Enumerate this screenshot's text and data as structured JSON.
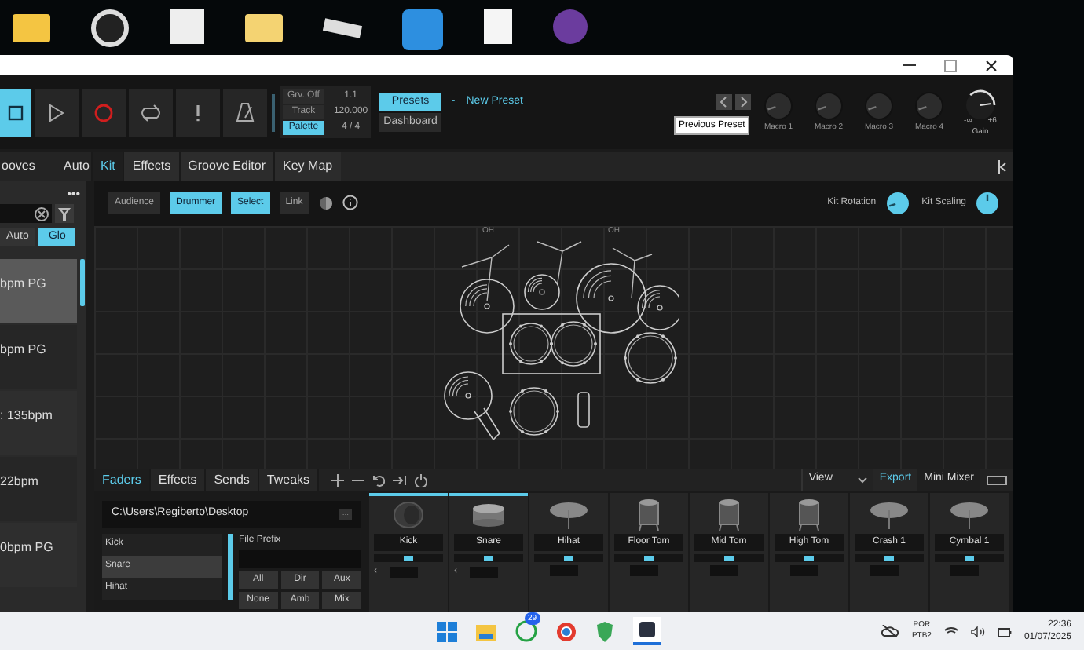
{
  "toolbar": {
    "transport": [
      {
        "kind": "stop",
        "selected": true
      },
      {
        "kind": "play",
        "selected": false
      },
      {
        "kind": "record",
        "selected": false
      },
      {
        "kind": "loop",
        "selected": false
      },
      {
        "kind": "alert",
        "selected": false
      },
      {
        "kind": "metronome",
        "selected": false
      }
    ],
    "info": [
      {
        "label": "Grv. Off",
        "value": "1.1",
        "selected": false
      },
      {
        "label": "Track",
        "value": "120.000",
        "selected": false
      },
      {
        "label": "Palette",
        "value": "4 / 4",
        "selected": true
      }
    ],
    "views": [
      {
        "label": "Presets",
        "selected": true
      },
      {
        "label": "Dashboard",
        "selected": false
      }
    ],
    "preset": {
      "separator": "-",
      "name": "New Preset"
    },
    "tooltip": "Previous Preset",
    "macros": [
      {
        "label": "Macro 1"
      },
      {
        "label": "Macro 2"
      },
      {
        "label": "Macro 3"
      },
      {
        "label": "Macro 4"
      }
    ],
    "gain": {
      "label": "Gain",
      "min": "-∞",
      "max": "+6"
    }
  },
  "left_tabs": [
    {
      "label": "ooves",
      "selected": false
    },
    {
      "label": "Auto",
      "selected": false
    }
  ],
  "tabs": [
    {
      "label": "Kit",
      "selected": true
    },
    {
      "label": "Effects",
      "selected": false
    },
    {
      "label": "Groove Editor",
      "selected": false
    },
    {
      "label": "Key Map",
      "selected": false
    }
  ],
  "browser": {
    "menu": "•••",
    "filters": [
      {
        "label": "Auto",
        "selected": false
      },
      {
        "label": "Glo",
        "selected": true
      }
    ],
    "items": [
      {
        "label": "bpm PG",
        "selected": true
      },
      {
        "label": "bpm PG",
        "selected": false
      },
      {
        "label": ": 135bpm",
        "selected": false
      },
      {
        "label": "22bpm",
        "selected": false
      },
      {
        "label": "0bpm PG",
        "selected": false
      }
    ]
  },
  "kit_toolbar": {
    "buttons": [
      {
        "label": "Audience",
        "selected": false
      },
      {
        "label": "Drummer",
        "selected": true
      },
      {
        "label": "Select",
        "selected": true
      },
      {
        "label": "Link",
        "selected": false
      }
    ],
    "knobs": [
      {
        "label": "Kit Rotation"
      },
      {
        "label": "Kit Scaling"
      }
    ]
  },
  "canvas": {
    "labels": [
      "OH",
      "OH"
    ]
  },
  "bottom_tabs": [
    {
      "label": "Faders",
      "selected": true
    },
    {
      "label": "Effects",
      "selected": false
    },
    {
      "label": "Sends",
      "selected": false
    },
    {
      "label": "Tweaks",
      "selected": false
    }
  ],
  "bottom_right": {
    "view": "View",
    "export": "Export",
    "mini_mixer": "Mini Mixer"
  },
  "export_panel": {
    "path": "C:\\Users\\Regiberto\\Desktop",
    "browse": "...",
    "prefix_label": "File Prefix",
    "tracks": [
      {
        "label": "Kick",
        "selected": false
      },
      {
        "label": "Snare",
        "selected": true
      },
      {
        "label": "Hihat",
        "selected": false
      }
    ],
    "buttons": [
      "All",
      "Dir",
      "Aux",
      "None",
      "Amb",
      "Mix"
    ]
  },
  "channels": [
    {
      "name": "Kick",
      "kind": "kick",
      "selected": true,
      "arrow": "‹"
    },
    {
      "name": "Snare",
      "kind": "snare",
      "selected": true,
      "arrow": "‹"
    },
    {
      "name": "Hihat",
      "kind": "cymbal",
      "selected": false
    },
    {
      "name": "Floor Tom",
      "kind": "tom",
      "selected": false
    },
    {
      "name": "Mid Tom",
      "kind": "tom",
      "selected": false
    },
    {
      "name": "High Tom",
      "kind": "tom",
      "selected": false
    },
    {
      "name": "Crash 1",
      "kind": "cymbal",
      "selected": false
    },
    {
      "name": "Cymbal 1",
      "kind": "cymbal",
      "selected": false
    }
  ],
  "taskbar": {
    "badge": "29",
    "language": "POR",
    "layout": "PTB2",
    "time": "22:36",
    "date": "01/07/2025"
  }
}
